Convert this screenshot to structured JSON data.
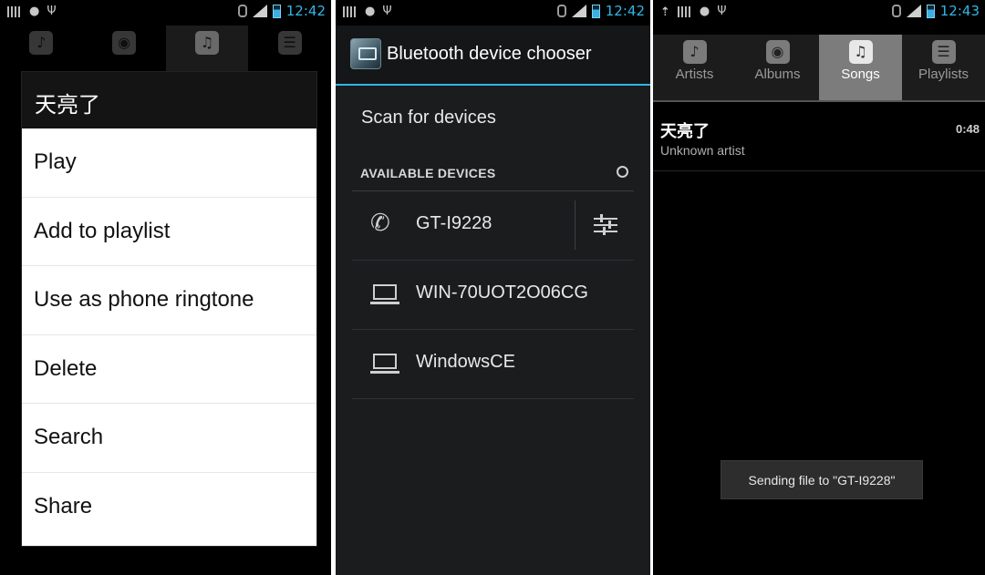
{
  "status_bars": [
    {
      "time": "12:42"
    },
    {
      "time": "12:42"
    },
    {
      "time": "12:43"
    }
  ],
  "tabs": [
    {
      "label": "Artists",
      "icon": "microphone-icon"
    },
    {
      "label": "Albums",
      "icon": "album-icon"
    },
    {
      "label": "Songs",
      "icon": "music-note-icon"
    },
    {
      "label": "Playlists",
      "icon": "list-icon"
    }
  ],
  "context_menu": {
    "title": "天亮了",
    "items": [
      "Play",
      "Add to playlist",
      "Use as phone ringtone",
      "Delete",
      "Search",
      "Share"
    ]
  },
  "bluetooth": {
    "title": "Bluetooth device chooser",
    "scan": "Scan for devices",
    "section": "AVAILABLE DEVICES",
    "devices": [
      {
        "name": "GT-I9228",
        "icon": "phone-icon"
      },
      {
        "name": "WIN-70UOT2O06CG",
        "icon": "laptop-icon"
      },
      {
        "name": "WindowsCE",
        "icon": "laptop-icon"
      }
    ]
  },
  "songs": {
    "active_tab": "Songs",
    "items": [
      {
        "title": "天亮了",
        "artist": "Unknown artist",
        "duration": "0:48"
      }
    ],
    "toast": "Sending file to \"GT-I9228\""
  },
  "colors": {
    "accent": "#33b5e5",
    "active_tab": "#7c7c7c"
  }
}
